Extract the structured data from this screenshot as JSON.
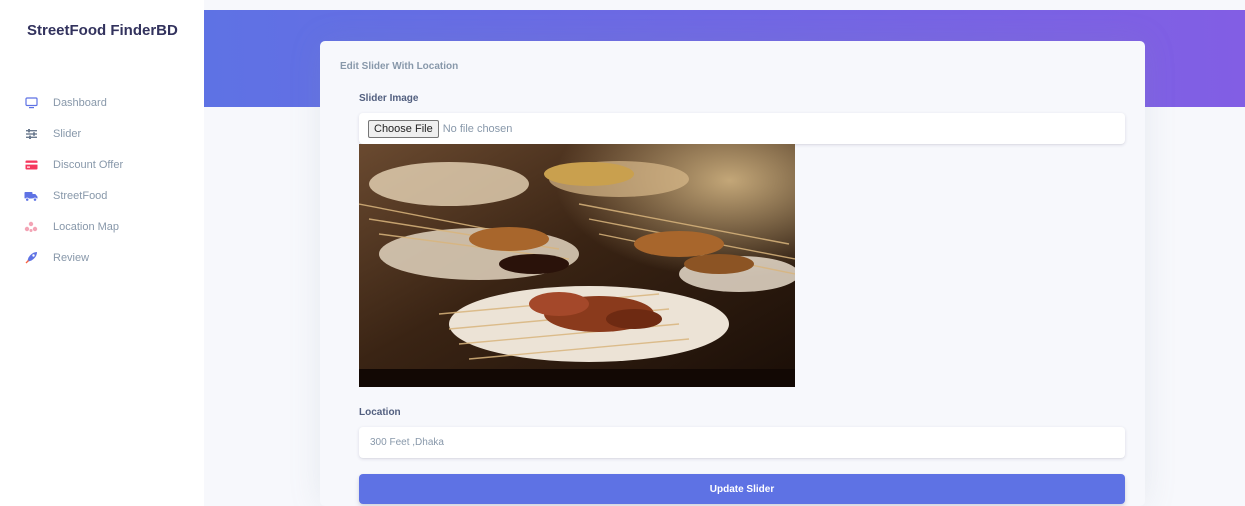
{
  "app": {
    "brand": "StreetFood FinderBD"
  },
  "sidebar": {
    "items": [
      {
        "label": "Dashboard",
        "icon": "monitor-icon",
        "color": "#5e72e4"
      },
      {
        "label": "Slider",
        "icon": "sliders-icon",
        "color": "#6b7a8f"
      },
      {
        "label": "Discount Offer",
        "icon": "credit-card-icon",
        "color": "#f5365c"
      },
      {
        "label": "StreetFood",
        "icon": "truck-icon",
        "color": "#5e72e4"
      },
      {
        "label": "Location Map",
        "icon": "map-pins-icon",
        "color": "#f3a4b5"
      },
      {
        "label": "Review",
        "icon": "rocket-icon",
        "color": "#5e72e4"
      }
    ]
  },
  "form": {
    "title": "Edit Slider With Location",
    "image_label": "Slider Image",
    "file_button": "Choose File",
    "file_status": "No file chosen",
    "location_label": "Location",
    "location_value": "300 Feet ,Dhaka",
    "submit_label": "Update Slider"
  },
  "colors": {
    "accent": "#5e72e4",
    "gradient_end": "#825ee4"
  }
}
